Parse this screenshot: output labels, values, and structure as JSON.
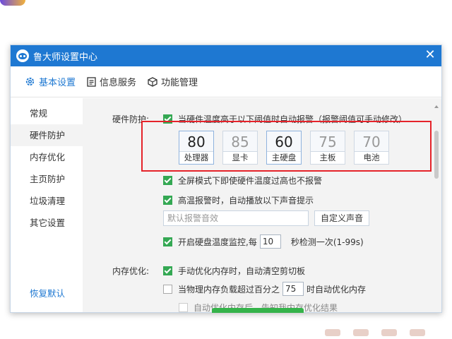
{
  "window": {
    "title": "鲁大师设置中心",
    "close_label": "✕"
  },
  "tabs": [
    {
      "label": "基本设置",
      "icon": "gear-icon"
    },
    {
      "label": "信息服务",
      "icon": "document-icon"
    },
    {
      "label": "功能管理",
      "icon": "cube-icon"
    }
  ],
  "sidebar": {
    "items": [
      {
        "label": "常规"
      },
      {
        "label": "硬件防护"
      },
      {
        "label": "内存优化"
      },
      {
        "label": "主页防护"
      },
      {
        "label": "垃圾清理"
      },
      {
        "label": "其它设置"
      }
    ],
    "restore_label": "恢复默认"
  },
  "hardware": {
    "section_label": "硬件防护:",
    "alert_option": "当硬件温度高于以下阈值时自动报警（报警阈值可手动修改）",
    "temps": [
      {
        "value": "80",
        "label": "处理器"
      },
      {
        "value": "85",
        "label": "显卡"
      },
      {
        "value": "60",
        "label": "主硬盘"
      },
      {
        "value": "75",
        "label": "主板"
      },
      {
        "value": "70",
        "label": "电池"
      }
    ],
    "fullscreen_option": "全屏模式下即使硬件温度过高也不报警",
    "sound_option": "高温报警时，自动播放以下声音提示",
    "sound_placeholder": "默认报警音效",
    "custom_sound_button": "自定义声音",
    "disk_monitor_prefix": "开启硬盘温度监控,每",
    "disk_monitor_value": "10",
    "disk_monitor_suffix": "秒检测一次(1-99s)"
  },
  "memory": {
    "section_label": "内存优化:",
    "clipboard_option": "手动优化内存时，自动清空剪切板",
    "auto_prefix": "当物理内存负载超过百分之",
    "auto_value": "75",
    "auto_suffix": "时自动优化内存",
    "notify_option": "自动优化内存后，告知我内存优化结果"
  }
}
